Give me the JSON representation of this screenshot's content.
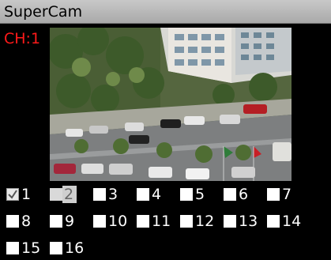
{
  "app": {
    "title": "SuperCam"
  },
  "viewer": {
    "channel_label": "CH:1"
  },
  "cameras": [
    {
      "label": "1",
      "checked": true
    },
    {
      "label": "2",
      "checked": false,
      "focused": true
    },
    {
      "label": "3",
      "checked": false
    },
    {
      "label": "4",
      "checked": false
    },
    {
      "label": "5",
      "checked": false
    },
    {
      "label": "6",
      "checked": false
    },
    {
      "label": "7",
      "checked": false
    },
    {
      "label": "8",
      "checked": false
    },
    {
      "label": "9",
      "checked": false
    },
    {
      "label": "10",
      "checked": false
    },
    {
      "label": "11",
      "checked": false
    },
    {
      "label": "12",
      "checked": false
    },
    {
      "label": "13",
      "checked": false
    },
    {
      "label": "14",
      "checked": false
    },
    {
      "label": "15",
      "checked": false
    },
    {
      "label": "16",
      "checked": false
    }
  ],
  "icons": {
    "checked": "checkmark-icon"
  }
}
